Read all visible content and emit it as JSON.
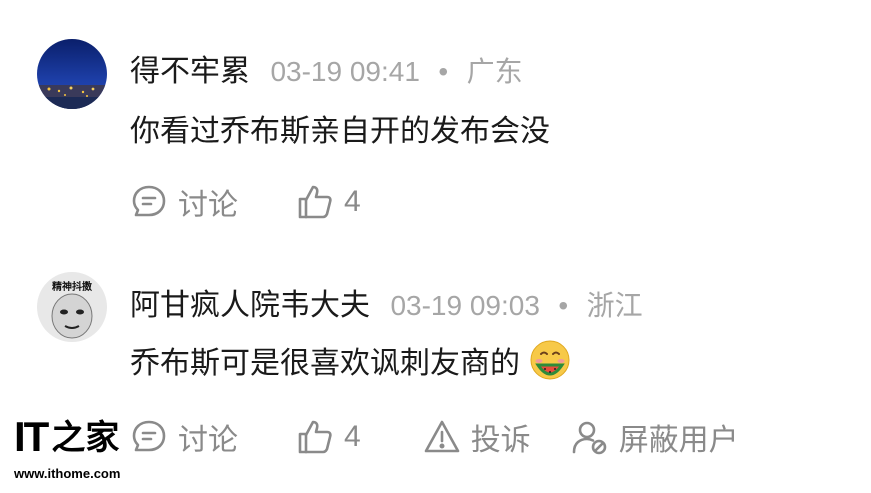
{
  "comments": [
    {
      "username": "得不牢累",
      "time": "03-19 09:41",
      "separator": "•",
      "location": "广东",
      "content": "你看过乔布斯亲自开的发布会没",
      "actions": {
        "discuss_label": "讨论",
        "like_count": "4"
      }
    },
    {
      "username": "阿甘疯人院韦大夫",
      "time": "03-19 09:03",
      "separator": "•",
      "location": "浙江",
      "content": "乔布斯可是很喜欢讽刺友商的",
      "emoji": "watermelon-face-emoji",
      "avatar_text": "精神抖擞",
      "actions": {
        "discuss_label": "讨论",
        "like_count": "4",
        "report_label": "投诉",
        "block_label": "屏蔽用户"
      }
    }
  ],
  "watermark": {
    "logo_it": "IT",
    "logo_zhi": "之家",
    "url": "www.ithome.com"
  },
  "icons": {
    "discuss": "chat-bubble-icon",
    "like": "thumbs-up-icon",
    "report": "warning-triangle-icon",
    "block": "user-block-icon"
  },
  "colors": {
    "text_primary": "#1a1a1a",
    "text_secondary": "#a6a6a6",
    "icon_gray": "#8a8a8a"
  }
}
